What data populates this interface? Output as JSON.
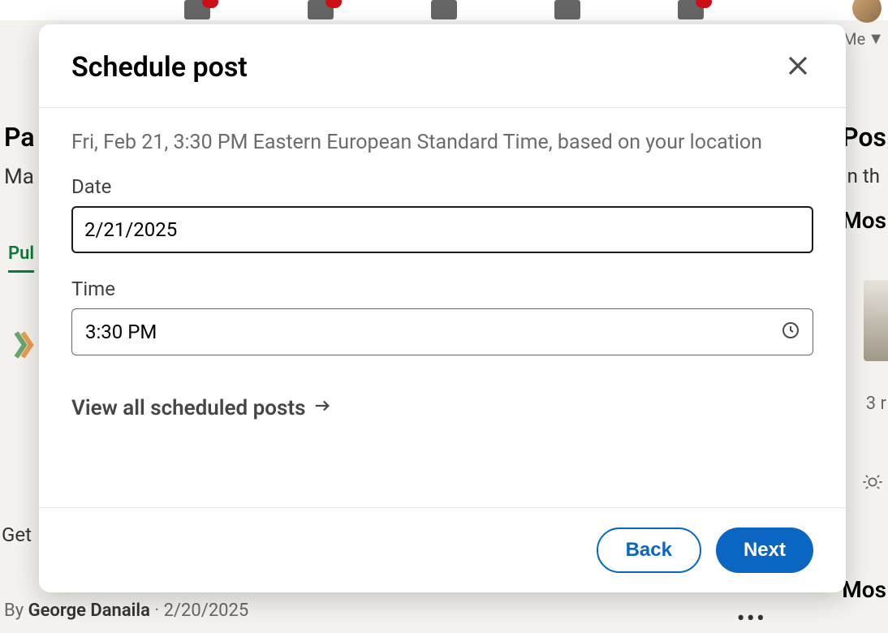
{
  "background": {
    "me_label": "Me",
    "left_title": "Pa",
    "left_sub": "Ma",
    "tab_label": "Pul",
    "bottom_text": "Get",
    "author_prefix": "By ",
    "author_name": "George Danaila",
    "author_date": " · 2/20/2025",
    "more_dots": "•••",
    "right_title": "Pos",
    "right_sub": "In th",
    "right_most": "Mos",
    "right_most2": "Mos",
    "thumb_text": "3 r"
  },
  "modal": {
    "title": "Schedule post",
    "location_text": "Fri, Feb 21, 3:30 PM Eastern European Standard Time, based on your location",
    "date_label": "Date",
    "date_value": "2/21/2025",
    "time_label": "Time",
    "time_value": "3:30 PM",
    "view_all_label": "View all scheduled posts",
    "back_label": "Back",
    "next_label": "Next"
  }
}
